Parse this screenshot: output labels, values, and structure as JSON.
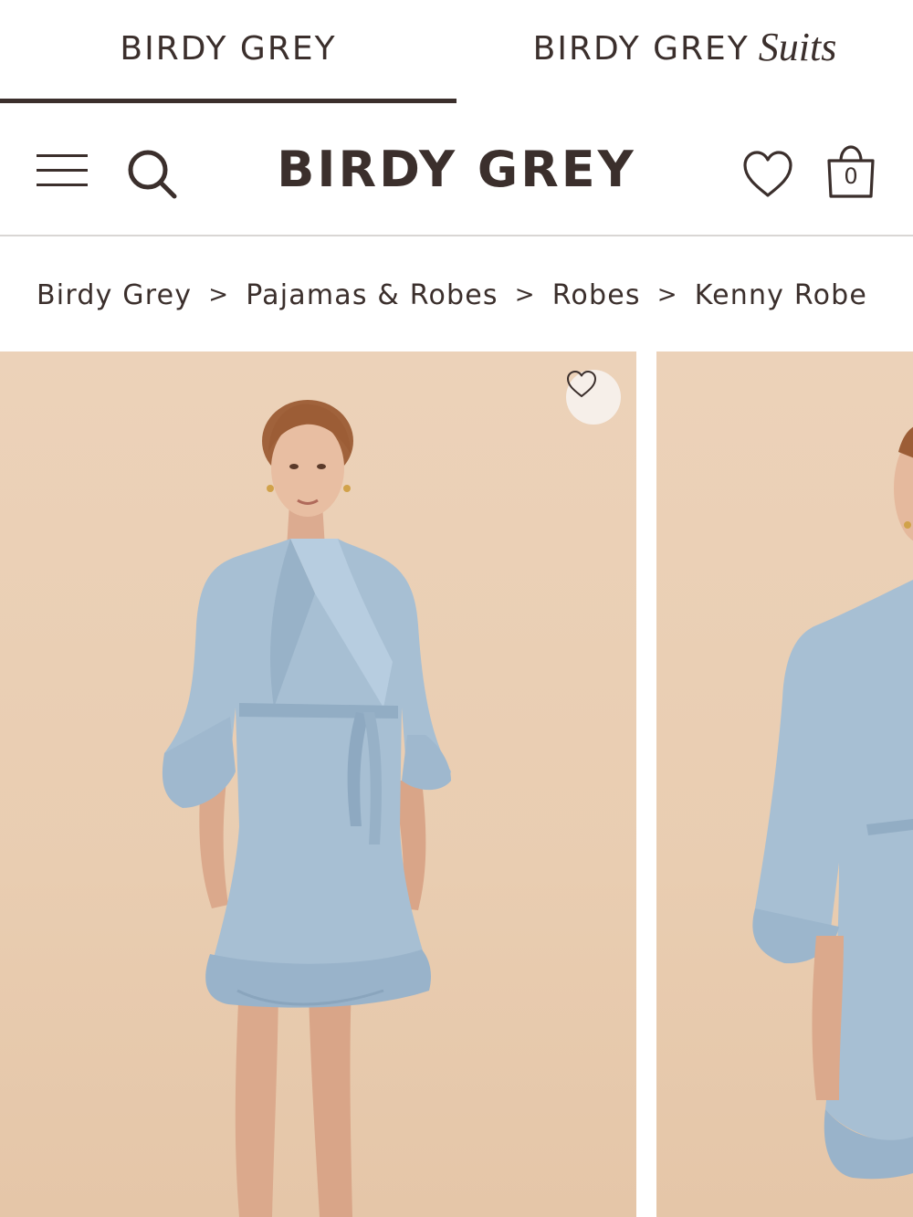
{
  "brand_tabs": {
    "primary": "BIRDY GREY",
    "secondary": "BIRDY GREY",
    "secondary_suffix": "Suits"
  },
  "header": {
    "logo": "BIRDY GREY",
    "menu_icon": "hamburger-menu-icon",
    "search_icon": "search-icon",
    "wishlist_icon": "heart-icon",
    "cart_icon": "shopping-bag-icon",
    "cart_count": "0"
  },
  "breadcrumb": {
    "items": [
      "Birdy Grey",
      "Pajamas & Robes",
      "Robes",
      "Kenny Robe"
    ],
    "separator": ">"
  },
  "gallery": {
    "favorite_icon": "heart-outline-icon",
    "slides": [
      "model-front-view",
      "model-side-view"
    ]
  },
  "colors": {
    "brand_text": "#3b2f2c",
    "backdrop": "#ecd2b9",
    "robe": "#a7bfd3"
  }
}
